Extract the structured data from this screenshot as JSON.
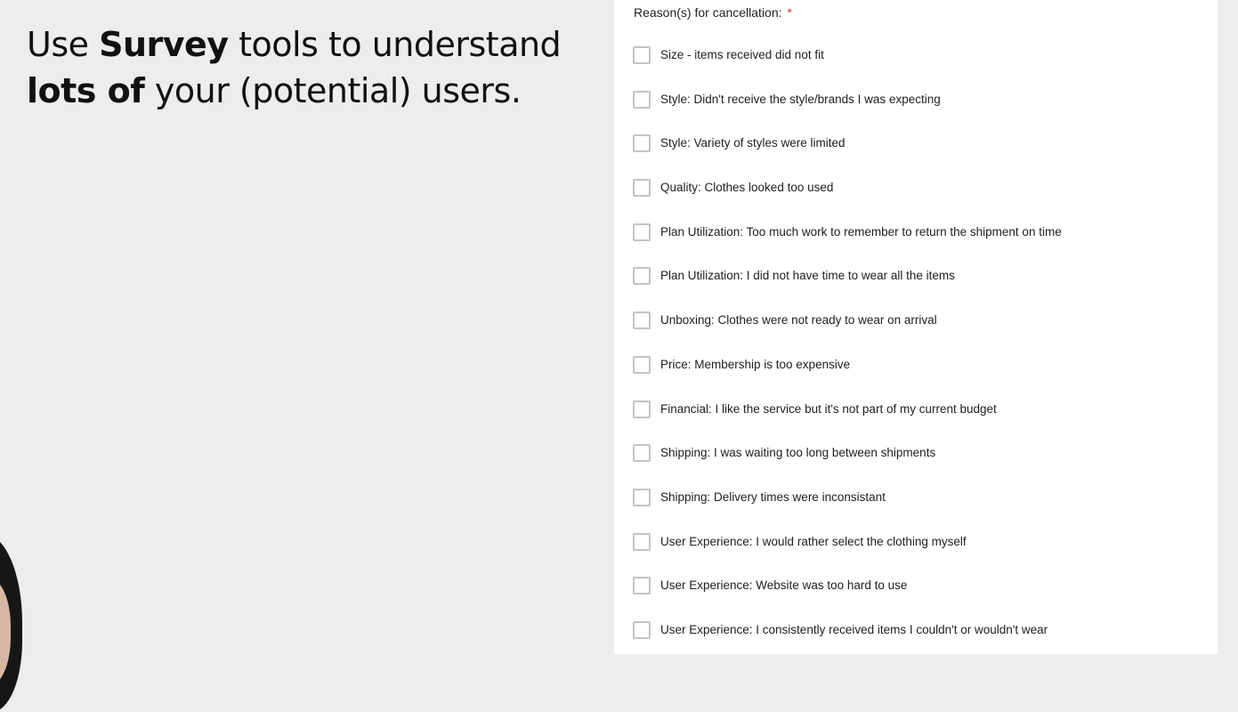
{
  "slide": {
    "headline": {
      "line1": [
        {
          "text": "Use ",
          "bold": false
        },
        {
          "text": "Survey",
          "bold": true
        },
        {
          "text": " tools to understand",
          "bold": false
        }
      ],
      "line2": [
        {
          "text": "lots of",
          "bold": true
        },
        {
          "text": " your (potential) users.",
          "bold": false
        }
      ]
    }
  },
  "form": {
    "question_label": "Reason(s) for cancellation:",
    "required_marker": "*",
    "options": [
      {
        "label": "Size - items received did not fit",
        "checked": false
      },
      {
        "label": "Style: Didn't receive the style/brands I was expecting",
        "checked": false
      },
      {
        "label": "Style: Variety of styles were limited",
        "checked": false
      },
      {
        "label": "Quality: Clothes looked too used",
        "checked": false
      },
      {
        "label": "Plan Utilization: Too much work to remember to return the shipment on time",
        "checked": false
      },
      {
        "label": "Plan Utilization: I did not have time to wear all the items",
        "checked": false
      },
      {
        "label": "Unboxing: Clothes were not ready to wear on arrival",
        "checked": false
      },
      {
        "label": "Price: Membership is too expensive",
        "checked": false
      },
      {
        "label": "Financial: I like the service but it's not part of my current budget",
        "checked": false
      },
      {
        "label": "Shipping: I was waiting too long between shipments",
        "checked": false
      },
      {
        "label": "Shipping: Delivery times were inconsistant",
        "checked": false
      },
      {
        "label": "User Experience: I would rather select the clothing myself",
        "checked": false
      },
      {
        "label": "User Experience: Website was too hard to use",
        "checked": false
      },
      {
        "label": "User Experience: I consistently received items I couldn't or wouldn't wear",
        "checked": false
      }
    ]
  },
  "colors": {
    "slide_background": "#ededed",
    "card_background": "#ffffff",
    "required_star": "#d93025",
    "checkbox_border": "#c4c4c4",
    "text": "#202124"
  }
}
